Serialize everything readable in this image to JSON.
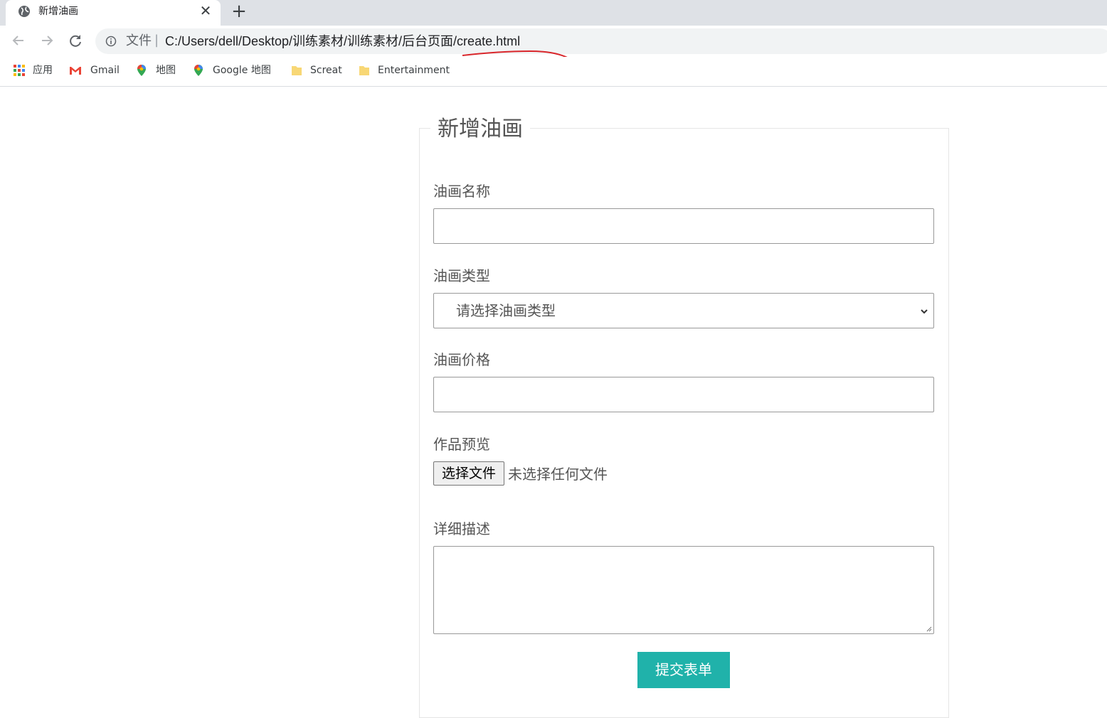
{
  "browser": {
    "tab_title": "新增油画",
    "close_glyph": "✕",
    "new_tab_glyph": "+",
    "omnibox": {
      "scheme_label": "文件",
      "separator": "|",
      "url": "C:/Users/dell/Desktop/训练素材/训练素材/后台页面/create.html"
    },
    "bookmarks": [
      {
        "label": "应用",
        "icon": "apps-grid-icon"
      },
      {
        "label": "Gmail",
        "icon": "gmail-icon"
      },
      {
        "label": "地图",
        "icon": "maps-pin-icon"
      },
      {
        "label": "Google 地图",
        "icon": "maps-pin-icon"
      },
      {
        "label": "Screat",
        "icon": "folder-icon"
      },
      {
        "label": "Entertainment",
        "icon": "folder-icon"
      }
    ]
  },
  "form": {
    "legend": "新增油画",
    "name_label": "油画名称",
    "name_value": "",
    "type_label": "油画类型",
    "type_selected": "请选择油画类型",
    "price_label": "油画价格",
    "price_value": "",
    "preview_label": "作品预览",
    "file_button": "选择文件",
    "file_status": "未选择任何文件",
    "desc_label": "详细描述",
    "desc_value": "",
    "submit_label": "提交表单"
  },
  "colors": {
    "accent": "#20b2aa",
    "annotation_ink": "#d9262b"
  }
}
